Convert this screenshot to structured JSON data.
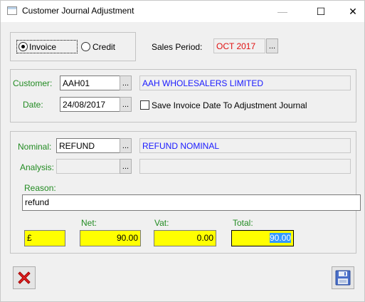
{
  "window": {
    "title": "Customer Journal Adjustment",
    "minimize_glyph": "—",
    "maximize_glyph": "☐",
    "close_glyph": "✕"
  },
  "type_panel": {
    "invoice_label": "Invoice",
    "credit_label": "Credit",
    "selected": "Invoice",
    "sales_period_label": "Sales Period:",
    "sales_period_value": "OCT 2017"
  },
  "customer_panel": {
    "customer_label": "Customer:",
    "customer_code": "AAH01",
    "customer_name": "AAH  WHOLESALERS LIMITED",
    "date_label": "Date:",
    "date_value": "24/08/2017",
    "save_date_label": "Save Invoice Date To Adjustment Journal",
    "save_date_checked": false
  },
  "nominal_panel": {
    "nominal_label": "Nominal:",
    "nominal_code": "REFUND",
    "nominal_name": "REFUND NOMINAL",
    "analysis_label": "Analysis:",
    "analysis_code": "",
    "analysis_name": "",
    "reason_label": "Reason:",
    "reason_value": "refund",
    "currency_symbol": "£",
    "net_label": "Net:",
    "net_value": "90.00",
    "vat_label": "Vat:",
    "vat_value": "0.00",
    "total_label": "Total:",
    "total_value": "90.00"
  },
  "lookup_glyph": "...",
  "colors": {
    "accent_green": "#228b22",
    "period_red": "#e01010",
    "name_blue": "#1a1aff",
    "amount_yellow": "#ffff00"
  }
}
